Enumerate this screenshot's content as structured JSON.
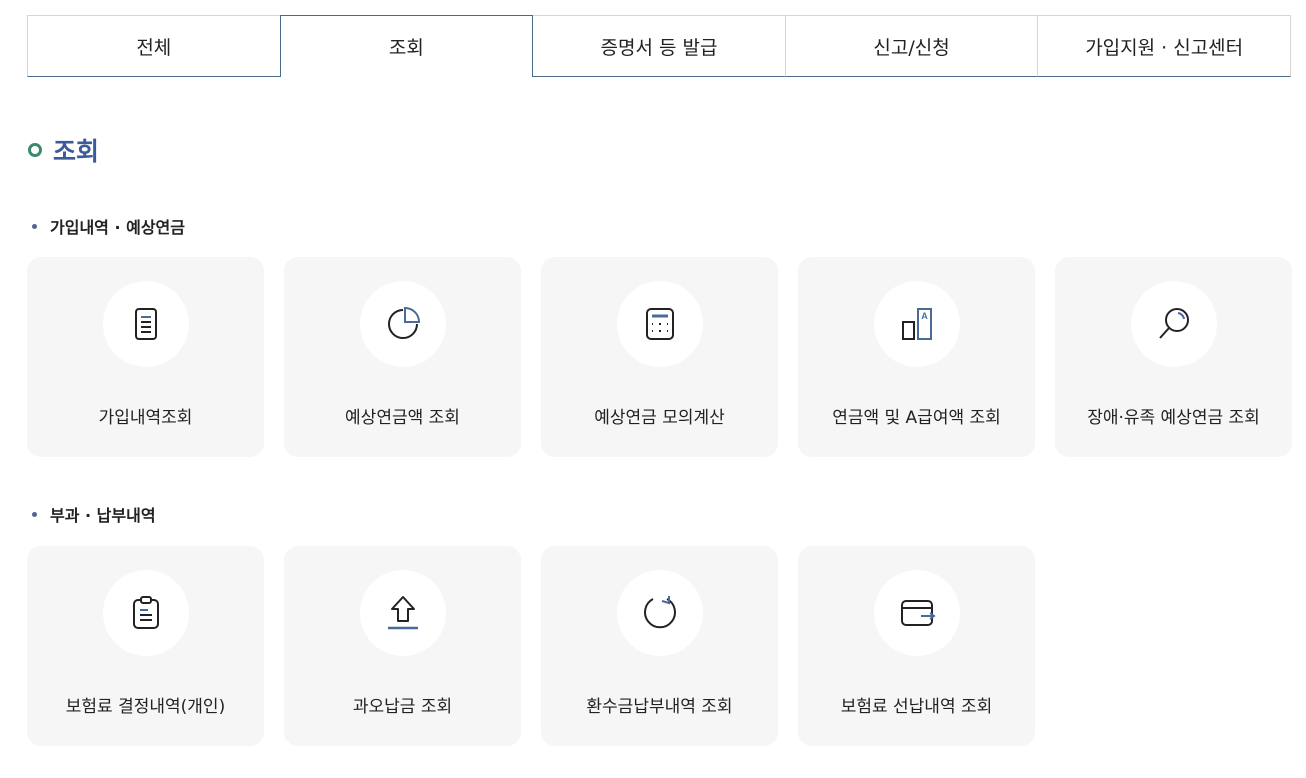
{
  "tabs": [
    {
      "label": "전체",
      "active": false
    },
    {
      "label": "조회",
      "active": true
    },
    {
      "label": "증명서 등 발급",
      "active": false
    },
    {
      "label": "신고/신청",
      "active": false
    },
    {
      "label": "가입지원 · 신고센터",
      "active": false
    }
  ],
  "page_title": "조회",
  "sections": [
    {
      "title": "가입내역 · 예상연금",
      "cards": [
        {
          "label": "가입내역조회",
          "icon": "document-icon"
        },
        {
          "label": "예상연금액 조회",
          "icon": "pie-chart-icon"
        },
        {
          "label": "예상연금 모의계산",
          "icon": "calculator-icon"
        },
        {
          "label": "연금액 및 A급여액 조회",
          "icon": "compare-bars-icon"
        },
        {
          "label": "장애·유족 예상연금 조회",
          "icon": "magnifier-icon"
        }
      ]
    },
    {
      "title": "부과 · 납부내역",
      "cards": [
        {
          "label": "보험료 결정내역(개인)",
          "icon": "clipboard-icon"
        },
        {
          "label": "과오납금 조회",
          "icon": "upload-arrow-icon"
        },
        {
          "label": "환수금납부내역 조회",
          "icon": "refresh-icon"
        },
        {
          "label": "보험료 선납내역 조회",
          "icon": "wallet-icon"
        }
      ]
    }
  ],
  "colors": {
    "accent_blue": "#3a5a9a",
    "accent_green": "#3c8a6a",
    "icon_stroke": "#222222",
    "icon_accent": "#4a6a9a",
    "card_bg": "#f6f6f6"
  }
}
